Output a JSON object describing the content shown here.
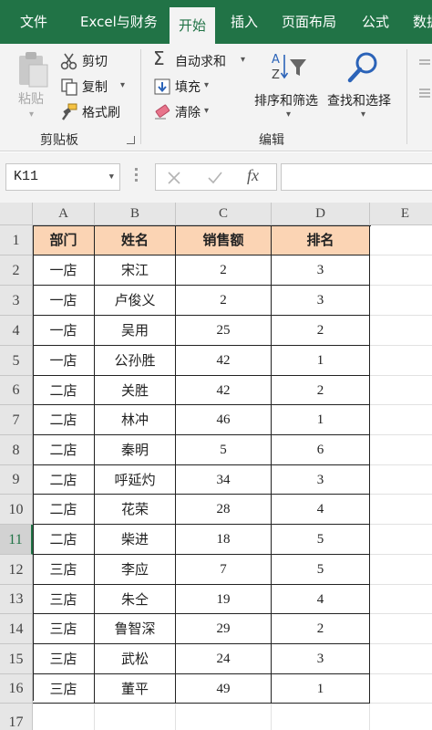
{
  "tabs": [
    "文件",
    "Excel与财务",
    "开始",
    "插入",
    "页面布局",
    "公式",
    "数据"
  ],
  "active_tab": "开始",
  "clipboard": {
    "paste": "粘贴",
    "cut": "剪切",
    "copy": "复制",
    "format_painter": "格式刷",
    "group_label": "剪贴板"
  },
  "editing": {
    "autosum": "自动求和",
    "fill": "填充",
    "clear": "清除",
    "sort_filter": "排序和筛选",
    "find_select": "查找和选择",
    "group_label": "编辑"
  },
  "formula_bar": {
    "name_box": "K11",
    "fx": "fx",
    "formula": ""
  },
  "columns": [
    "A",
    "B",
    "C",
    "D",
    "E"
  ],
  "row_numbers": [
    "1",
    "2",
    "3",
    "4",
    "5",
    "6",
    "7",
    "8",
    "9",
    "10",
    "11",
    "12",
    "13",
    "14",
    "15",
    "16",
    "17"
  ],
  "selected_row": "11",
  "table": {
    "headers": [
      "部门",
      "姓名",
      "销售额",
      "排名"
    ],
    "rows": [
      [
        "一店",
        "宋江",
        "2",
        "3"
      ],
      [
        "一店",
        "卢俊义",
        "2",
        "3"
      ],
      [
        "一店",
        "吴用",
        "25",
        "2"
      ],
      [
        "一店",
        "公孙胜",
        "42",
        "1"
      ],
      [
        "二店",
        "关胜",
        "42",
        "2"
      ],
      [
        "二店",
        "林冲",
        "46",
        "1"
      ],
      [
        "二店",
        "秦明",
        "5",
        "6"
      ],
      [
        "二店",
        "呼延灼",
        "34",
        "3"
      ],
      [
        "二店",
        "花荣",
        "28",
        "4"
      ],
      [
        "二店",
        "柴进",
        "18",
        "5"
      ],
      [
        "三店",
        "李应",
        "7",
        "5"
      ],
      [
        "三店",
        "朱仝",
        "19",
        "4"
      ],
      [
        "三店",
        "鲁智深",
        "29",
        "2"
      ],
      [
        "三店",
        "武松",
        "24",
        "3"
      ],
      [
        "三店",
        "董平",
        "49",
        "1"
      ]
    ]
  },
  "colors": {
    "excel_green": "#217346",
    "header_fill": "#fbd4b4"
  }
}
